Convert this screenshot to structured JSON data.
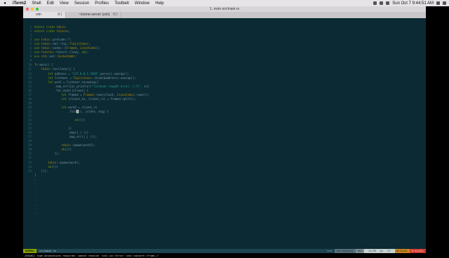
{
  "menubar": {
    "items": [
      "iTerm2",
      "Shell",
      "Edit",
      "View",
      "Session",
      "Profiles",
      "Toolbelt",
      "Window",
      "Help"
    ],
    "clock": "Sun Oct 7  9:44:51 AM"
  },
  "window": {
    "title": "1. nvim src/main.rs",
    "tabs": [
      {
        "label": "vim",
        "shortcut": "⌘1"
      },
      {
        "label": "~/some-server (zsh)",
        "shortcut": "⌘2"
      }
    ]
  },
  "editor": {
    "line_numbers": [
      "1",
      "2",
      "3",
      "4",
      "5",
      "6",
      "7",
      "8",
      "9",
      "10",
      "11",
      "12",
      "13",
      "14",
      "15",
      "16",
      "17",
      "18",
      "19",
      "20",
      "21",
      "22",
      "23",
      "24",
      "25",
      "26",
      "27",
      "28",
      "29",
      "30",
      "31",
      "32",
      "33",
      "34",
      "35"
    ],
    "lines": [
      "extern crate tokio;",
      "extern crate futures;",
      "",
      "use tokio::prelude::*;",
      "use tokio::net::tcp::TcpListener;",
      "use tokio::codec::{Framed, LinesCodec};",
      "use futures::future::{lazy, ok};",
      "use std::net::SocketAddr;",
      "",
      "fn main() {",
      "    tokio::run(lazy(|| {",
      "        let address = \"127.0.0.1:3456\".parse().unwrap();",
      "        let listener = TcpListener::bind(&address).unwrap();",
      "        let work = listener.incoming()",
      "            .map_err(|e| println!(\"listener caught error: {:?}\", e))",
      "            .for_each(|client| {",
      "                let framed = Framed::new(client, LinesCodec::new());",
      "                let (client_tx, client_rx) = framed.split();",
      "",
      "                let work2 = client_rx",
      "                    .fold((), |state, msg| {",
      "",
      "                        ok(())",
      "",
      "                    })",
      "                    .map(|_| ())",
      "                    .map_err(|_| ());",
      "",
      "                tokio::spawn(work2);",
      "                ok(())",
      "            });",
      "",
      "        tokio::spawn(work);",
      "        ok(())",
      "    }));"
    ],
    "after_lines": [
      "}"
    ],
    "tilde_count": 10
  },
  "statusline": {
    "mode": "NORMAL",
    "file": "src/main.rs",
    "filetype": "rust",
    "encoding": "utf-8[unix]",
    "percent": "60%",
    "position": "21/35",
    "column": "27",
    "warnings": "W:1(L4)",
    "errors": "E:1(L21)"
  },
  "cmdline": "[E0282] type annotations required: cannot resolve `std::io::Error: std::convert::From<_>`"
}
